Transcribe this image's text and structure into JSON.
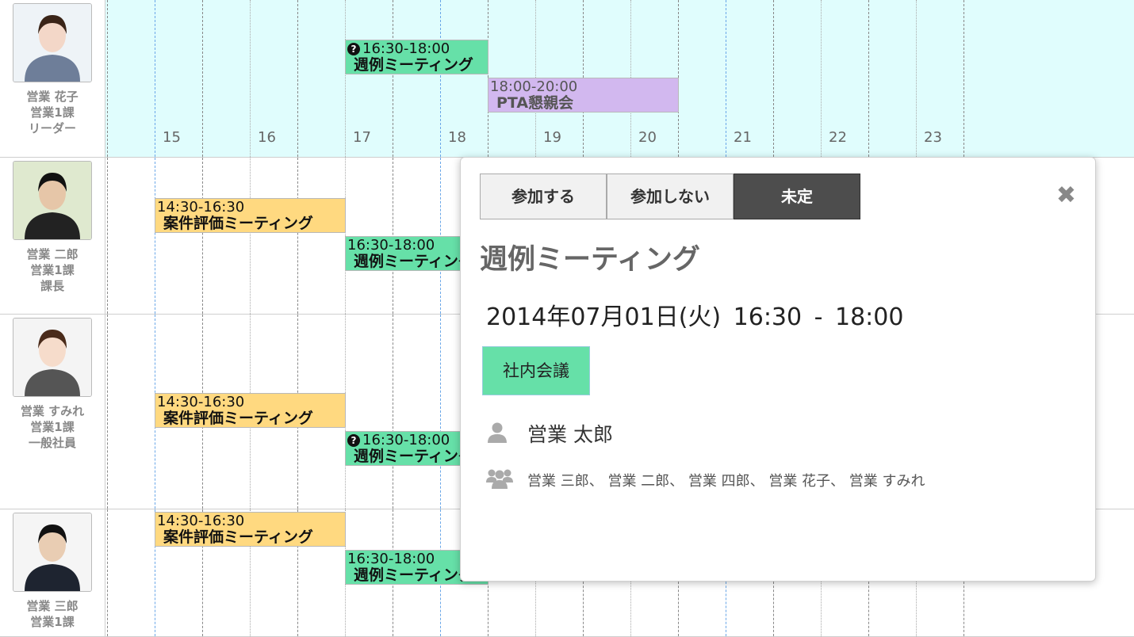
{
  "hours": [
    "15",
    "16",
    "17",
    "18",
    "19",
    "20",
    "21",
    "22",
    "23"
  ],
  "users": [
    {
      "lines": [
        "営業 花子",
        "営業1課",
        "リーダー"
      ],
      "events": [
        {
          "time": "16:30-18:00",
          "name": "週例ミーティング",
          "color": "green",
          "unconfirmed": true
        },
        {
          "time": "18:00-20:00",
          "name": "PTA懇親会",
          "color": "purple",
          "unconfirmed": false
        }
      ]
    },
    {
      "lines": [
        "営業 二郎",
        "営業1課",
        "課長"
      ],
      "events": [
        {
          "time": "14:30-16:30",
          "name": "案件評価ミーティング",
          "color": "yellow",
          "unconfirmed": false
        },
        {
          "time": "16:30-18:00",
          "name": "週例ミーティング",
          "color": "green",
          "unconfirmed": false
        }
      ]
    },
    {
      "lines": [
        "営業 すみれ",
        "営業1課",
        "一般社員"
      ],
      "events": [
        {
          "time": "14:30-16:30",
          "name": "案件評価ミーティング",
          "color": "yellow",
          "unconfirmed": false
        },
        {
          "time": "16:30-18:00",
          "name": "週例ミーティング",
          "color": "green",
          "unconfirmed": true
        }
      ]
    },
    {
      "lines": [
        "営業 三郎",
        "営業1課"
      ],
      "events": [
        {
          "time": "14:30-16:30",
          "name": "案件評価ミーティング",
          "color": "yellow",
          "unconfirmed": false
        },
        {
          "time": "16:30-18:00",
          "name": "週例ミーティング",
          "color": "green",
          "unconfirmed": false
        }
      ]
    }
  ],
  "popup": {
    "buttons": {
      "attend": "参加する",
      "decline": "参加しない",
      "undecided": "未定"
    },
    "active_button": "未定",
    "close_glyph": "✖",
    "title": "週例ミーティング",
    "datetime": "2014年07月01日(火) 16:30 - 18:00",
    "category": "社内会議",
    "owner": "営業 太郎",
    "members": "営業 三郎、 営業 二郎、 営業 四郎、 営業 花子、 営業 すみれ"
  },
  "colors": {
    "highlight_row": "#e0fdfd",
    "green": "#66e0a8",
    "yellow": "#ffd980",
    "purple": "#d2b8ef"
  }
}
